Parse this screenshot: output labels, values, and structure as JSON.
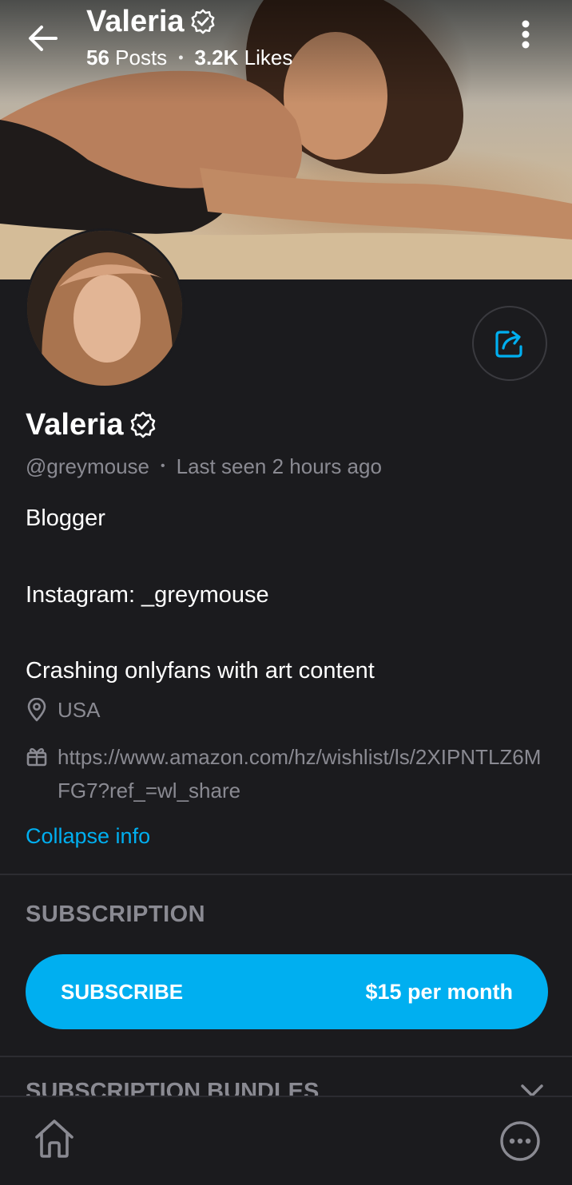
{
  "header": {
    "name": "Valeria",
    "posts_count": "56",
    "posts_label": "Posts",
    "likes_count": "3.2K",
    "likes_label": "Likes",
    "separator": "•"
  },
  "profile": {
    "name": "Valeria",
    "handle": "@greymouse",
    "separator": "•",
    "last_seen": "Last seen 2 hours ago",
    "bio_lines": [
      "Blogger",
      "Instagram: _greymouse",
      "Crashing onlyfans with art content"
    ],
    "location": "USA",
    "wishlist_url": "https://www.amazon.com/hz/wishlist/ls/2XIPNTLZ6MFG7?ref_=wl_share",
    "collapse_label": "Collapse info"
  },
  "subscription": {
    "section_title": "SUBSCRIPTION",
    "button_label": "SUBSCRIBE",
    "price_label": "$15 per month",
    "bundles_title": "SUBSCRIPTION BUNDLES"
  },
  "colors": {
    "background": "#1b1b1e",
    "accent": "#00aff0",
    "muted_text": "#8a8a92",
    "divider": "#2c2c31"
  },
  "icons": {
    "back": "arrow-left-icon",
    "more": "vertical-dots-icon",
    "verified": "verified-badge-icon",
    "share": "share-icon",
    "location": "location-pin-icon",
    "wishlist": "gift-icon",
    "chevron": "chevron-down-icon",
    "home": "home-icon",
    "nav_more": "more-horizontal-icon"
  }
}
